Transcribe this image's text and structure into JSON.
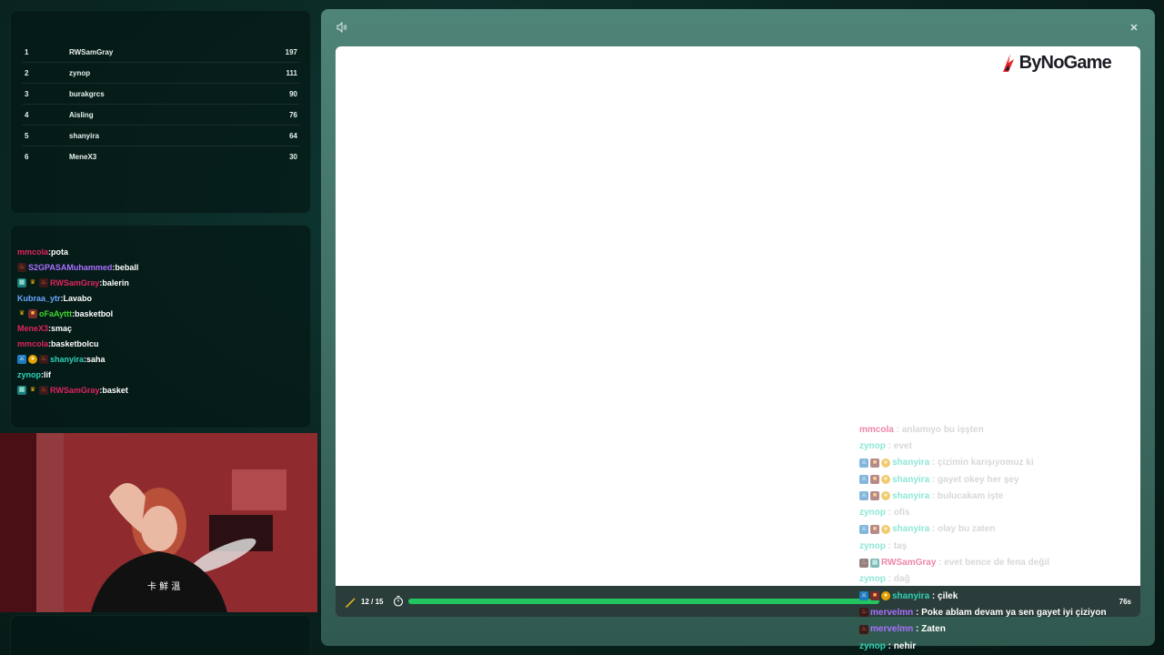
{
  "leaderboard": {
    "rows": [
      {
        "rank": "1",
        "name": "RWSamGray",
        "score": "197"
      },
      {
        "rank": "2",
        "name": "zynop",
        "score": "111"
      },
      {
        "rank": "3",
        "name": "burakgrcs",
        "score": "90"
      },
      {
        "rank": "4",
        "name": "Aisling",
        "score": "76"
      },
      {
        "rank": "5",
        "name": "shanyira",
        "score": "64"
      },
      {
        "rank": "6",
        "name": "MeneX3",
        "score": "30"
      }
    ]
  },
  "chat": {
    "messages": [
      {
        "badges": [],
        "user": "mmcola",
        "color": "#e0245e",
        "text": "pota"
      },
      {
        "badges": [
          "flame"
        ],
        "user": "S2GPASAMuhammed",
        "color": "#a970ff",
        "text": "beball"
      },
      {
        "badges": [
          "grid",
          "crown",
          "flame"
        ],
        "user": "RWSamGray",
        "color": "#e0245e",
        "text": "balerin"
      },
      {
        "badges": [],
        "user": "Kubraa_ytr",
        "color": "#6aa6ff",
        "text": "Lavabo"
      },
      {
        "badges": [
          "crown",
          "box"
        ],
        "user": "oFaAyttt",
        "color": "#44d62c",
        "text": "basketbol"
      },
      {
        "badges": [],
        "user": "MeneX3",
        "color": "#e0245e",
        "text": "smaç"
      },
      {
        "badges": [],
        "user": "mmcola",
        "color": "#e0245e",
        "text": "basketbolcu"
      },
      {
        "badges": [
          "sword",
          "coin",
          "flame"
        ],
        "user": "shanyira",
        "color": "#2ed3b7",
        "text": "saha"
      },
      {
        "badges": [],
        "user": "zynop",
        "color": "#2ed3b7",
        "text": "lif"
      },
      {
        "badges": [
          "grid",
          "crown",
          "flame"
        ],
        "user": "RWSamGray",
        "color": "#e0245e",
        "text": "basket"
      }
    ]
  },
  "game": {
    "logo": "ByNoGame",
    "round": "12 / 15",
    "time_left": "76s",
    "progress": 0.8,
    "colors": {
      "progress": "#22c55e",
      "canvas": "#ffffff"
    }
  },
  "overlay_chat": {
    "messages": [
      {
        "badges": [],
        "user": "mmcola",
        "color": "#e0245e",
        "text": "anlamıyo bu işşten",
        "faded": true
      },
      {
        "badges": [],
        "user": "zynop",
        "color": "#2ed3b7",
        "text": "evet",
        "faded": true
      },
      {
        "badges": [
          "sword",
          "box",
          "coin"
        ],
        "user": "shanyira",
        "color": "#2ed3b7",
        "text": "çizimin karışıyomuz ki",
        "faded": true
      },
      {
        "badges": [
          "sword",
          "box",
          "coin"
        ],
        "user": "shanyira",
        "color": "#2ed3b7",
        "text": "gayet okey her şey",
        "faded": true
      },
      {
        "badges": [
          "sword",
          "box",
          "coin"
        ],
        "user": "shanyira",
        "color": "#2ed3b7",
        "text": "bulucakam işte",
        "faded": true
      },
      {
        "badges": [],
        "user": "zynop",
        "color": "#2ed3b7",
        "text": "ofis",
        "faded": true
      },
      {
        "badges": [
          "sword",
          "box",
          "coin"
        ],
        "user": "shanyira",
        "color": "#2ed3b7",
        "text": "olay bu zaten",
        "faded": true
      },
      {
        "badges": [],
        "user": "zynop",
        "color": "#2ed3b7",
        "text": "taş",
        "faded": true
      },
      {
        "badges": [
          "flame",
          "grid"
        ],
        "user": "RWSamGray",
        "color": "#e0245e",
        "text": "evet bence de fena değil",
        "faded": true
      },
      {
        "badges": [],
        "user": "zynop",
        "color": "#2ed3b7",
        "text": "dağ",
        "faded": true
      },
      {
        "badges": [
          "sword",
          "box",
          "coin"
        ],
        "user": "shanyira",
        "color": "#2ed3b7",
        "text": "çilek",
        "faded": false
      },
      {
        "badges": [
          "flame"
        ],
        "user": "mervelmn",
        "color": "#a970ff",
        "text": "Poke ablam devam ya sen gayet iyi çiziyon",
        "faded": false
      },
      {
        "badges": [
          "flame"
        ],
        "user": "mervelmn",
        "color": "#a970ff",
        "text": "Zaten",
        "faded": false
      },
      {
        "badges": [],
        "user": "zynop",
        "color": "#2ed3b7",
        "text": "nehir",
        "faded": false
      }
    ]
  },
  "icons": {
    "sound": "speaker-icon",
    "close": "close-icon",
    "pencil": "pencil-icon",
    "timer": "stopwatch-icon"
  }
}
